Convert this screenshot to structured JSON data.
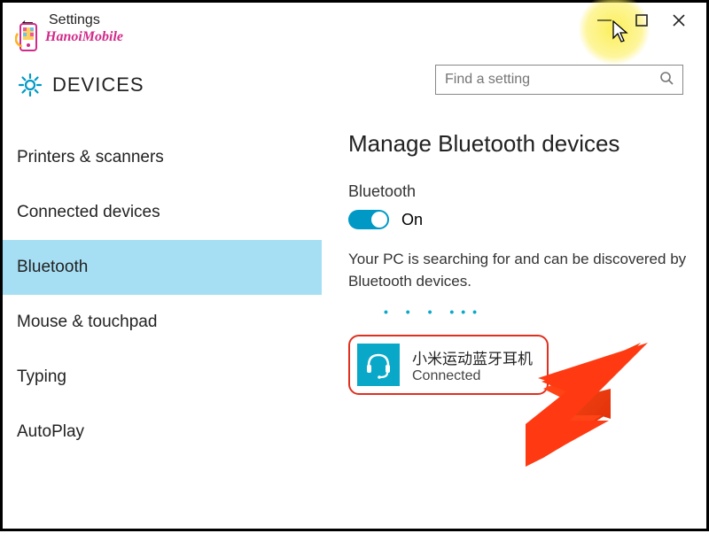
{
  "titlebar": {
    "title": "Settings"
  },
  "logo": {
    "text": "HanoiMobile"
  },
  "section": {
    "title": "DEVICES"
  },
  "search": {
    "placeholder": "Find a setting"
  },
  "sidebar": {
    "items": [
      {
        "label": "Printers & scanners"
      },
      {
        "label": "Connected devices"
      },
      {
        "label": "Bluetooth"
      },
      {
        "label": "Mouse & touchpad"
      },
      {
        "label": "Typing"
      },
      {
        "label": "AutoPlay"
      }
    ],
    "selected_index": 2
  },
  "main": {
    "heading": "Manage Bluetooth devices",
    "bt_label": "Bluetooth",
    "toggle_state": "On",
    "status_text": "Your PC is searching for and can be discovered by Bluetooth devices.",
    "device": {
      "name": "小米运动蓝牙耳机",
      "status": "Connected"
    }
  }
}
